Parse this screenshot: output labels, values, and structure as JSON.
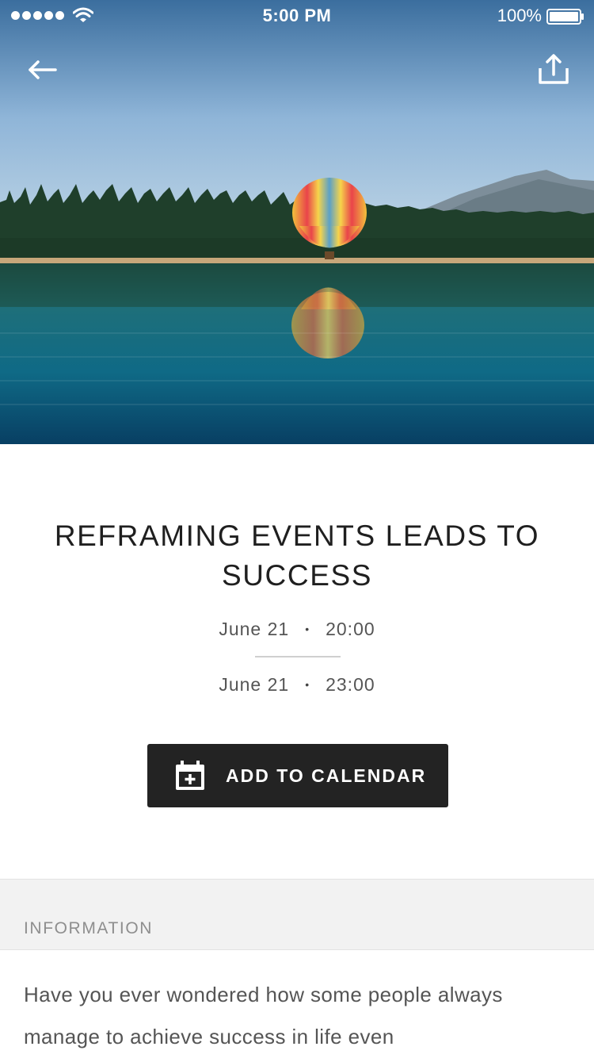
{
  "status_bar": {
    "time": "5:00 PM",
    "battery_percent": "100%",
    "signal_dots": 5,
    "battery_level": 1.0
  },
  "nav": {
    "back_icon": "arrow-left-icon",
    "share_icon": "share-upload-icon"
  },
  "hero": {
    "description_icon": "hot-air-balloon-photo"
  },
  "event": {
    "title": "REFRAMING EVENTS LEADS TO SUCCESS",
    "start_date": "June 21",
    "start_time": "20:00",
    "end_date": "June 21",
    "end_time": "23:00",
    "separator": "•"
  },
  "actions": {
    "add_to_calendar": "ADD TO CALENDAR",
    "calendar_icon": "calendar-plus-icon"
  },
  "information": {
    "header": "INFORMATION",
    "body": "Have you ever wondered how some people always manage to achieve success in life even"
  },
  "colors": {
    "button_bg": "#232323",
    "section_bg": "#f2f2f2",
    "text_primary": "#1f1f1f",
    "text_secondary": "#555555"
  }
}
